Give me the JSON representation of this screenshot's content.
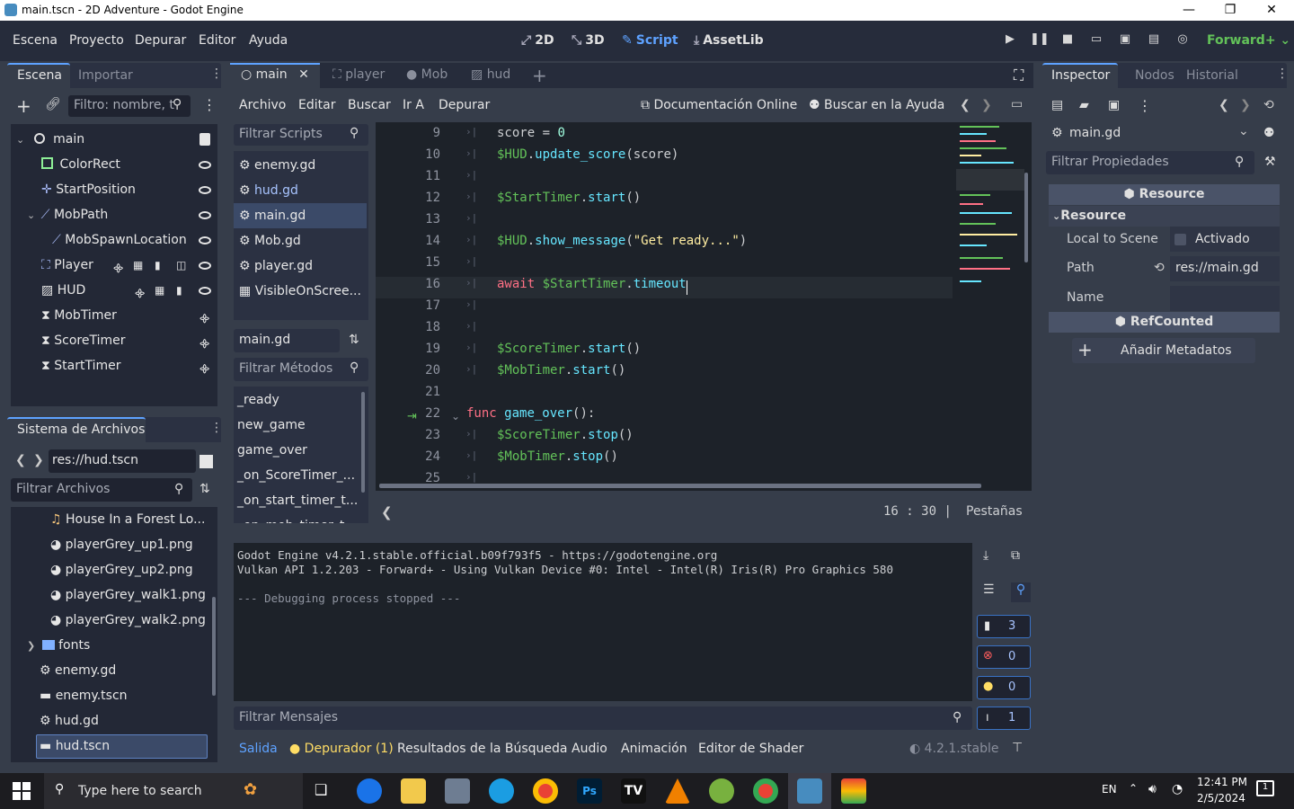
{
  "window": {
    "title": "main.tscn - 2D Adventure - Godot Engine",
    "minimize": "—",
    "restore": "❐",
    "close": "✕"
  },
  "menu": [
    "Escena",
    "Proyecto",
    "Depurar",
    "Editor",
    "Ayuda"
  ],
  "workspaces": [
    {
      "label": "2D",
      "glyph": "⤢"
    },
    {
      "label": "3D",
      "glyph": "⤡"
    },
    {
      "label": "Script",
      "glyph": "✎"
    },
    {
      "label": "AssetLib",
      "glyph": "⤓"
    }
  ],
  "renderer": "Forward+",
  "scene_dock": {
    "tabs": [
      "Escena",
      "Importar"
    ],
    "filter_placeholder": "Filtro: nombre, t",
    "nodes": [
      {
        "name": "main",
        "icon": "node-icon"
      },
      {
        "name": "ColorRect",
        "icon": "colorrect-icon"
      },
      {
        "name": "StartPosition",
        "icon": "marker-icon"
      },
      {
        "name": "MobPath",
        "icon": "path-icon"
      },
      {
        "name": "MobSpawnLocation",
        "icon": "pathfollow-icon"
      },
      {
        "name": "Player",
        "icon": "area-icon"
      },
      {
        "name": "HUD",
        "icon": "canvaslayer-icon"
      },
      {
        "name": "MobTimer",
        "icon": "timer-icon"
      },
      {
        "name": "ScoreTimer",
        "icon": "timer-icon"
      },
      {
        "name": "StartTimer",
        "icon": "timer-icon"
      }
    ]
  },
  "filesystem": {
    "title": "Sistema de Archivos",
    "path": "res://hud.tscn",
    "filter_placeholder": "Filtrar Archivos",
    "items": [
      "House In a Forest Lo...",
      "playerGrey_up1.png",
      "playerGrey_up2.png",
      "playerGrey_walk1.png",
      "playerGrey_walk2.png",
      "fonts",
      "enemy.gd",
      "enemy.tscn",
      "hud.gd",
      "hud.tscn"
    ]
  },
  "editor_tabs": [
    "main",
    "player",
    "Mob",
    "hud"
  ],
  "script_menu": [
    "Archivo",
    "Editar",
    "Buscar",
    "Ir A",
    "Depurar"
  ],
  "script_tools": {
    "docs": "Documentación Online",
    "help": "Buscar en la Ayuda"
  },
  "scripts": {
    "filter_placeholder": "Filtrar Scripts",
    "items": [
      "enemy.gd",
      "hud.gd",
      "main.gd",
      "Mob.gd",
      "player.gd",
      "VisibleOnScree..."
    ],
    "current": "main.gd"
  },
  "methods": {
    "filter_placeholder": "Filtrar Métodos",
    "items": [
      "_ready",
      "new_game",
      "game_over",
      "_on_ScoreTimer_...",
      "_on_start_timer_t...",
      "_on_mob_timer_t..."
    ]
  },
  "code": {
    "numbers": [
      "9",
      "10",
      "11",
      "12",
      "13",
      "14",
      "15",
      "16",
      "17",
      "18",
      "19",
      "20",
      "21",
      "22",
      "23",
      "24",
      "25"
    ],
    "lines": [
      [
        [
          "tx",
          "score = "
        ],
        [
          "nm",
          "0"
        ]
      ],
      [
        [
          "nd",
          "$HUD"
        ],
        [
          "tx",
          "."
        ],
        [
          "fn",
          "update_score"
        ],
        [
          "tx",
          "(score)"
        ]
      ],
      [],
      [
        [
          "nd",
          "$StartTimer"
        ],
        [
          "tx",
          "."
        ],
        [
          "fn",
          "start"
        ],
        [
          "tx",
          "()"
        ]
      ],
      [],
      [
        [
          "nd",
          "$HUD"
        ],
        [
          "tx",
          "."
        ],
        [
          "fn",
          "show_message"
        ],
        [
          "tx",
          "("
        ],
        [
          "st",
          "\"Get ready...\""
        ],
        [
          "tx",
          ")"
        ]
      ],
      [],
      [
        [
          "kw",
          "await "
        ],
        [
          "nd",
          "$StartTimer"
        ],
        [
          "tx",
          "."
        ],
        [
          "fn",
          "timeout"
        ]
      ],
      [],
      [],
      [
        [
          "nd",
          "$ScoreTimer"
        ],
        [
          "tx",
          "."
        ],
        [
          "fn",
          "start"
        ],
        [
          "tx",
          "()"
        ]
      ],
      [
        [
          "nd",
          "$MobTimer"
        ],
        [
          "tx",
          "."
        ],
        [
          "fn",
          "start"
        ],
        [
          "tx",
          "()"
        ]
      ],
      [],
      [
        [
          "kw",
          "func "
        ],
        [
          "fn",
          "game_over"
        ],
        [
          "tx",
          "():"
        ]
      ],
      [
        [
          "nd",
          "$ScoreTimer"
        ],
        [
          "tx",
          "."
        ],
        [
          "fn",
          "stop"
        ],
        [
          "tx",
          "()"
        ]
      ],
      [
        [
          "nd",
          "$MobTimer"
        ],
        [
          "tx",
          "."
        ],
        [
          "fn",
          "stop"
        ],
        [
          "tx",
          "()"
        ]
      ],
      []
    ]
  },
  "status": {
    "line": "16",
    "col": "30",
    "indent": "Pestañas"
  },
  "output": {
    "lines": [
      "Godot Engine v4.2.1.stable.official.b09f793f5 - https://godotengine.org",
      "Vulkan API 1.2.203 - Forward+ - Using Vulkan Device #0: Intel - Intel(R) Iris(R) Pro Graphics 580",
      "",
      "--- Debugging process stopped ---"
    ],
    "filter_placeholder": "Filtrar Mensajes",
    "counts": {
      "messages": "3",
      "errors": "0",
      "warnings": "0",
      "info": "1"
    }
  },
  "bottom_tabs": [
    "Salida",
    "Depurador (1)",
    "Resultados de la Búsqueda",
    "Audio",
    "Animación",
    "Editor de Shader"
  ],
  "version": "4.2.1.stable",
  "inspector": {
    "tabs": [
      "Inspector",
      "Nodos",
      "Historial"
    ],
    "resource": "main.gd",
    "filter_placeholder": "Filtrar Propiedades",
    "section1": "Resource",
    "group": "Resource",
    "local_label": "Local to Scene",
    "local_value": "Activado",
    "path_label": "Path",
    "path_value": "res://main.gd",
    "name_label": "Name",
    "section2": "RefCounted",
    "add_meta": "Añadir Metadatos"
  },
  "taskbar": {
    "search": "Type here to search",
    "lang": "EN",
    "time": "12:41 PM",
    "date": "2/5/2024",
    "notif": "1"
  }
}
